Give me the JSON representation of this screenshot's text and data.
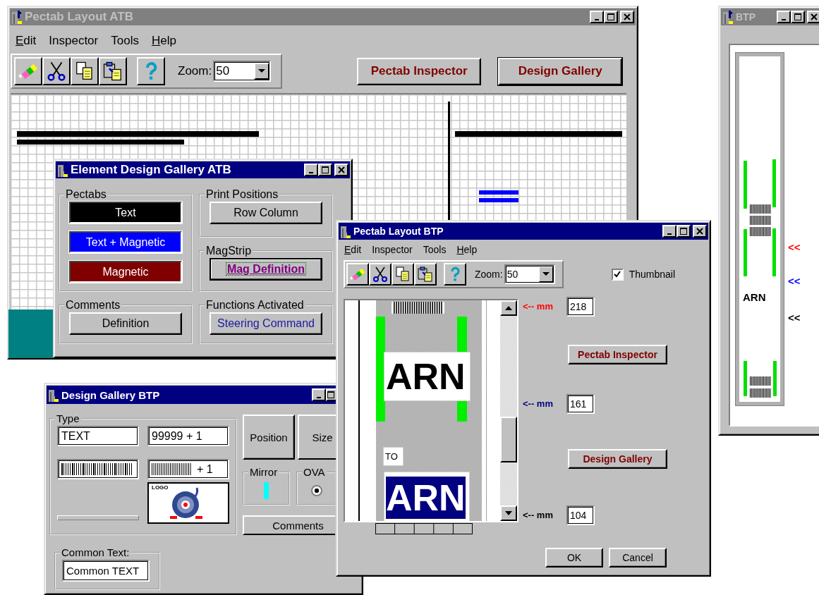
{
  "windows": [
    {
      "kind": "atb_layout",
      "title": "Pectab Layout ATB",
      "active": false,
      "menu": [
        {
          "label": "Edit",
          "underline_first": true
        },
        {
          "label": "Inspector",
          "underline_first": false
        },
        {
          "label": "Tools",
          "underline_first": false
        },
        {
          "label": "Help",
          "underline_first": true
        }
      ],
      "zoom_label": "Zoom:",
      "zoom": "50",
      "buttons": [
        {
          "label": "Pectab Inspector",
          "default": false
        },
        {
          "label": "Design Gallery",
          "default": true
        }
      ]
    },
    {
      "kind": "thumbnail",
      "title": "BTP",
      "active": false,
      "label": "ARN",
      "markers": [
        {
          "text": "<<",
          "color": "#ff0000"
        },
        {
          "text": "<<",
          "color": "#0000ff"
        },
        {
          "text": "<<",
          "color": "#000000"
        }
      ]
    },
    {
      "kind": "element_gallery",
      "title": "Element Design Gallery ATB",
      "active": true,
      "groups": [
        {
          "title": "Pectabs",
          "buttons": [
            {
              "label": "Text",
              "kind": "swatch",
              "color": "#000000"
            },
            {
              "label": "Text + Magnetic",
              "kind": "swatch",
              "color": "#0000ff"
            },
            {
              "label": "Magnetic",
              "kind": "swatch",
              "color": "#800000"
            }
          ]
        },
        {
          "title": "Print Positions",
          "buttons": [
            {
              "label": "Row Column",
              "kind": "plain"
            }
          ]
        },
        {
          "title": "MagStrip",
          "buttons": [
            {
              "label": "Mag Definition",
              "kind": "focused"
            }
          ]
        },
        {
          "title": "Comments",
          "buttons": [
            {
              "label": "Definition",
              "kind": "plain"
            }
          ]
        },
        {
          "title": "Functions Activated",
          "buttons": [
            {
              "label": "Steering Command",
              "kind": "accent"
            }
          ]
        }
      ]
    },
    {
      "kind": "design_gallery",
      "title": "Design Gallery BTP",
      "active": true,
      "type_group": {
        "title": "Type",
        "text_field": "TEXT",
        "counter_field": "99999 + 1",
        "barcode_suffix": "+ 1",
        "logo_label": "LOGO"
      },
      "buttons": [
        "Position",
        "Size"
      ],
      "mirror": {
        "title": "Mirror"
      },
      "ova": {
        "title": "OVA",
        "selected": true
      },
      "comments_button": "Comments",
      "common_text": {
        "title": "Common Text:",
        "value": "Common TEXT"
      }
    },
    {
      "kind": "btp_layout",
      "title": "Pectab Layout BTP",
      "active": true,
      "menu": [
        {
          "label": "Edit",
          "underline_first": true
        },
        {
          "label": "Inspector",
          "underline_first": false
        },
        {
          "label": "Tools",
          "underline_first": false
        },
        {
          "label": "Help",
          "underline_first": true
        }
      ],
      "zoom_label": "Zoom:",
      "zoom": "50",
      "thumbnail": {
        "label": "Thumbnail",
        "checked": true
      },
      "ticket": {
        "to_label": "TO",
        "fields": [
          {
            "text": "ARN",
            "selected": false
          },
          {
            "text": "ARN",
            "selected": true
          }
        ]
      },
      "positions": [
        {
          "marker": "<-- mm",
          "color": "#ff0000",
          "value": "218"
        },
        {
          "marker": "<-- mm",
          "color": "#000080",
          "value": "161"
        },
        {
          "marker": "<-- mm",
          "color": "#000000",
          "value": "104"
        }
      ],
      "side_buttons": [
        "Pectab Inspector",
        "Design Gallery"
      ],
      "dialog_buttons": [
        "OK",
        "Cancel"
      ]
    }
  ]
}
